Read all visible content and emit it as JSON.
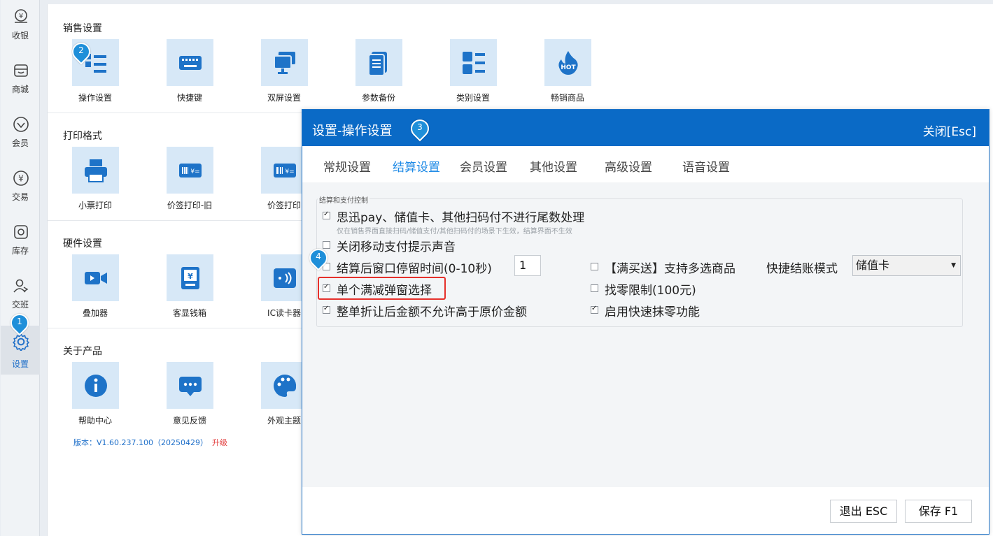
{
  "sidebar": {
    "items": [
      {
        "label": "收银",
        "icon": "cash-register-icon"
      },
      {
        "label": "商城",
        "icon": "store-icon"
      },
      {
        "label": "会员",
        "icon": "member-diamond-icon"
      },
      {
        "label": "交易",
        "icon": "yuan-transaction-icon"
      },
      {
        "label": "库存",
        "icon": "inventory-icon"
      },
      {
        "label": "交班",
        "icon": "shift-handover-icon"
      },
      {
        "label": "设置",
        "icon": "gear-icon"
      }
    ],
    "active": "设置"
  },
  "sections": [
    {
      "title": "销售设置",
      "tiles": [
        "操作设置",
        "快捷键",
        "双屏设置",
        "参数备份",
        "类别设置",
        "畅销商品"
      ]
    },
    {
      "title": "打印格式",
      "tiles": [
        "小票打印",
        "价签打印-旧",
        "价签打印"
      ]
    },
    {
      "title": "硬件设置",
      "tiles": [
        "叠加器",
        "客显钱箱",
        "IC读卡器"
      ]
    },
    {
      "title": "关于产品",
      "tiles": [
        "帮助中心",
        "意见反馈",
        "外观主题"
      ]
    }
  ],
  "hot_badge": "HOT",
  "version": {
    "text": "版本：V1.60.237.100（20250429）",
    "upgrade": "升级"
  },
  "dialog": {
    "title": "设置-操作设置",
    "close": "关闭[Esc]",
    "tabs": [
      "常规设置",
      "结算设置",
      "会员设置",
      "其他设置",
      "高级设置",
      "语音设置"
    ],
    "active_tab": "结算设置",
    "group_legend": "结算和支付控制",
    "options": {
      "no_rounding": {
        "label": "思迅pay、储值卡、其他扫码付不进行尾数处理",
        "checked": true,
        "hint": "仅在销售界面直接扫码/储值支付/其他扫码付的场景下生效，结算界面不生效"
      },
      "close_mobile_sound": {
        "label": "关闭移动支付提示声音",
        "checked": false
      },
      "window_stay": {
        "label": "结算后窗口停留时间(0-10秒)",
        "checked": false,
        "value": "1"
      },
      "single_discount_popup": {
        "label": "单个满减弹窗选择",
        "checked": true
      },
      "no_higher_than_original": {
        "label": "整单折让后金额不允许高于原价金额",
        "checked": true
      },
      "multi_select_promo": {
        "label": "【满买送】支持多选商品",
        "checked": false
      },
      "change_limit": {
        "label": "找零限制(100元)",
        "checked": false
      },
      "quick_round": {
        "label": "启用快速抹零功能",
        "checked": true
      },
      "quick_checkout_mode": {
        "label": "快捷结账模式",
        "value": "储值卡"
      }
    },
    "buttons": {
      "exit": "退出 ESC",
      "save": "保存 F1"
    }
  },
  "markers": [
    "1",
    "2",
    "3",
    "4"
  ],
  "colors": {
    "accent": "#0a6ac6",
    "tile_bg": "#d7e8f7",
    "icon": "#1e73c8",
    "highlight": "#e6302b"
  }
}
